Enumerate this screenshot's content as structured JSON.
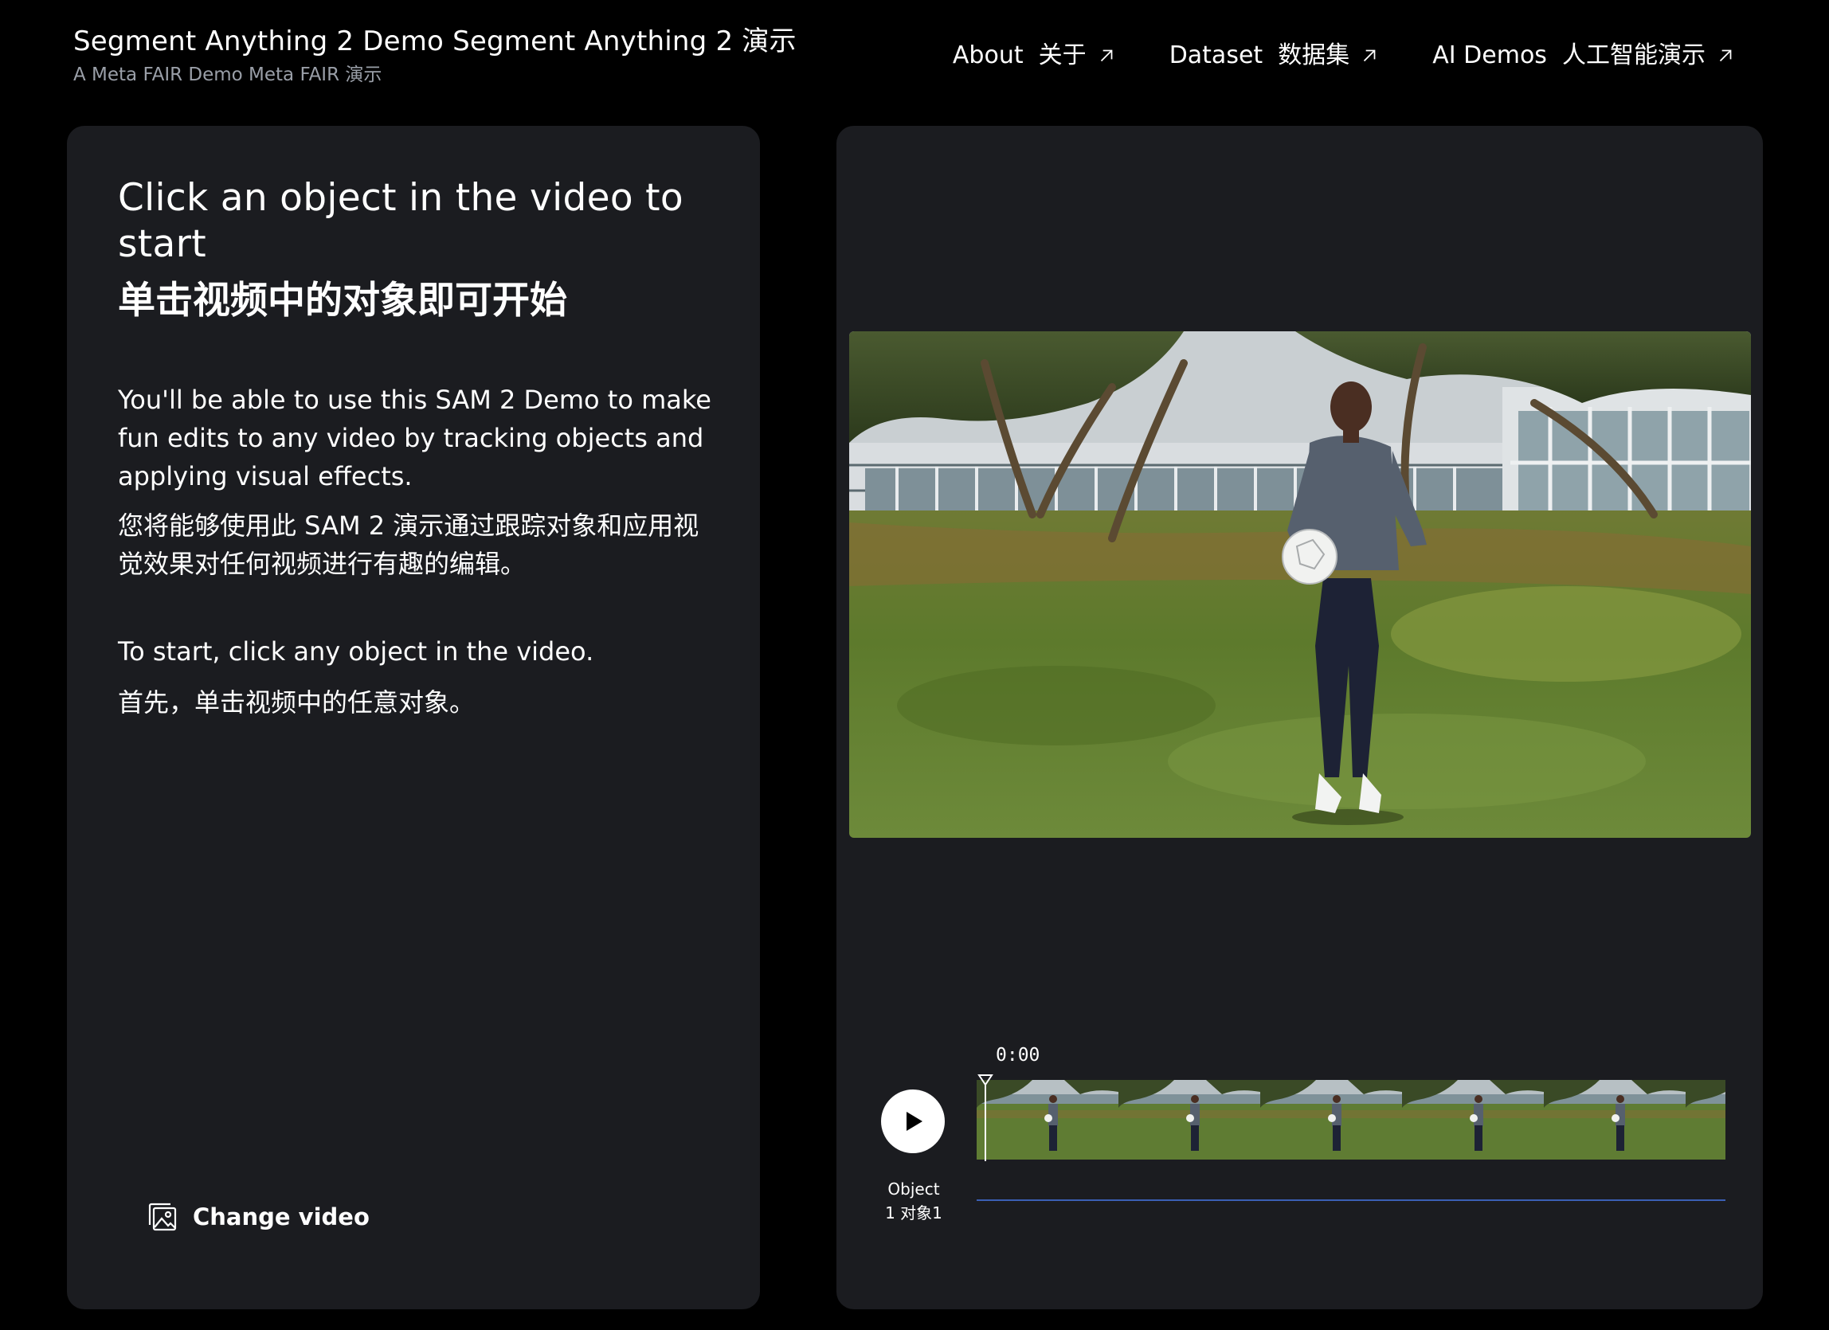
{
  "header": {
    "title": "Segment Anything 2 Demo Segment Anything 2 演示",
    "subtitle": "A Meta FAIR Demo Meta FAIR 演示",
    "nav": [
      {
        "label": "About  关于",
        "icon": "arrow-up-right-icon"
      },
      {
        "label": "Dataset  数据集",
        "icon": "arrow-up-right-icon"
      },
      {
        "label": "AI Demos  人工智能演示",
        "icon": "arrow-up-right-icon"
      }
    ]
  },
  "intro": {
    "heading_en": "Click an object in the video to start",
    "heading_zh": "单击视频中的对象即可开始",
    "body_en": "You'll be able to use this SAM 2 Demo to make fun edits to any video by tracking objects and applying visual effects.",
    "body_zh": "您将能够使用此 SAM 2 演示通过跟踪对象和应用视觉效果对任何视频进行有趣的编辑。",
    "start_en": "To start, click any object in the video.",
    "start_zh": "首先，单击视频中的任意对象。"
  },
  "actions": {
    "change_video_label": "Change video",
    "change_video_icon": "image-gallery-icon"
  },
  "player": {
    "time": "0:00",
    "play_icon": "play-icon",
    "object_label": "Object\n1 对象1",
    "track_color": "#3b5fb5"
  },
  "colors": {
    "background": "#000000",
    "panel": "#1b1c20",
    "text": "#ffffff",
    "muted": "#9a9fa8"
  }
}
